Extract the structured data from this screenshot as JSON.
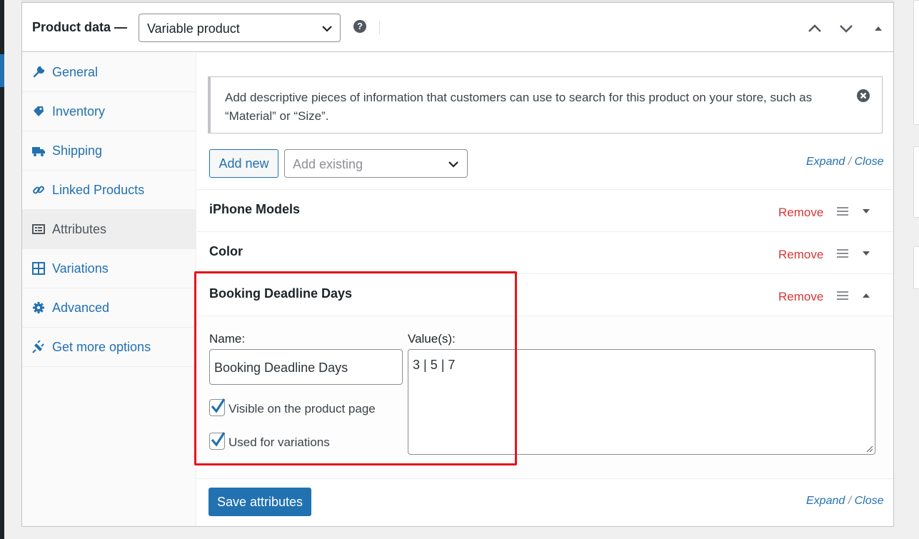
{
  "header": {
    "title": "Product data —",
    "product_type": "Variable product",
    "help": "?"
  },
  "sidebar": {
    "items": [
      {
        "label": "General",
        "icon": "wrench-icon"
      },
      {
        "label": "Inventory",
        "icon": "tag-icon"
      },
      {
        "label": "Shipping",
        "icon": "truck-icon"
      },
      {
        "label": "Linked Products",
        "icon": "link-icon"
      },
      {
        "label": "Attributes",
        "icon": "list-icon",
        "active": true
      },
      {
        "label": "Variations",
        "icon": "grid-icon"
      },
      {
        "label": "Advanced",
        "icon": "gear-icon"
      },
      {
        "label": "Get more options",
        "icon": "plugin-icon"
      }
    ]
  },
  "notice": {
    "text": "Add descriptive pieces of information that customers can use to search for this product on your store, such as “Material” or “Size”."
  },
  "toolbar": {
    "add_new": "Add new",
    "add_existing_placeholder": "Add existing",
    "expand": "Expand",
    "slash": "/",
    "close": "Close"
  },
  "attributes": [
    {
      "name": "iPhone Models",
      "remove": "Remove",
      "expanded": false
    },
    {
      "name": "Color",
      "remove": "Remove",
      "expanded": false
    },
    {
      "name": "Booking Deadline Days",
      "remove": "Remove",
      "expanded": true
    }
  ],
  "attribute_detail": {
    "name_label": "Name:",
    "name_value": "Booking Deadline Days",
    "values_label": "Value(s):",
    "values_value": "3 | 5 | 7",
    "visible_label": "Visible on the product page",
    "visible_checked": true,
    "variations_label": "Used for variations",
    "variations_checked": true
  },
  "footer": {
    "save": "Save attributes",
    "expand": "Expand",
    "slash": "/",
    "close": "Close"
  },
  "colors": {
    "link": "#2271b1",
    "remove": "#d63638",
    "highlight": "#e8141b",
    "primary_button": "#2271b1"
  }
}
